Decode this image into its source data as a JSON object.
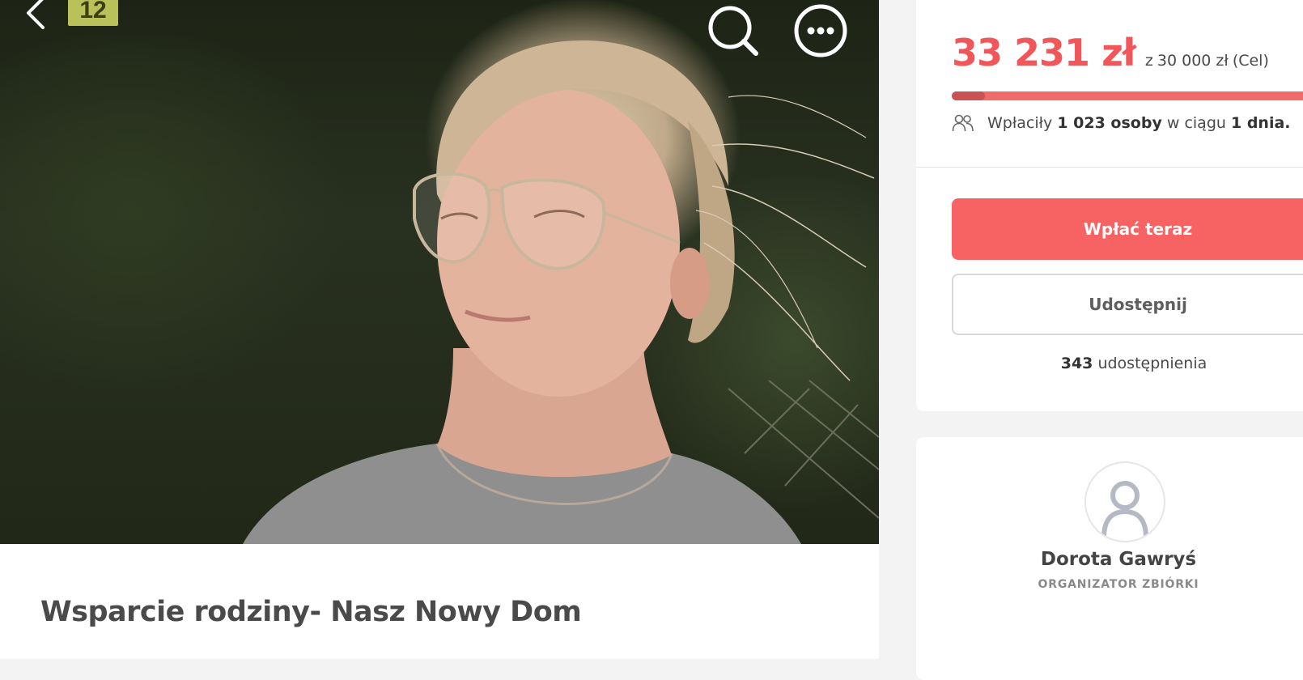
{
  "hero": {
    "photo_counter": "12",
    "icons": {
      "back": "chevron-left-icon",
      "search": "search-icon",
      "more": "more-horizontal-icon"
    }
  },
  "campaign": {
    "title": "Wsparcie rodziny- Nasz Nowy Dom"
  },
  "donation": {
    "raised": "33 231 zł",
    "goal_prefix": "z",
    "goal_amount": "30 000 zł",
    "goal_label": "(Cel)",
    "progress_fraction": 1.0,
    "donors_prefix": "Wpłaciły",
    "donors_count": "1 023 osoby",
    "donors_mid": "w ciągu",
    "donors_period": "1 dnia.",
    "donate_button": "Wpłać teraz",
    "share_button": "Udostępnij",
    "shares_count": "343",
    "shares_label": "udostępnienia"
  },
  "organizer": {
    "name": "Dorota Gawryś",
    "role": "ORGANIZATOR ZBIÓRKI"
  },
  "colors": {
    "accent": "#f76363",
    "raised_text": "#f0575a",
    "progress_track": "#f26a6c",
    "counter_badge": "#b9c25a"
  }
}
